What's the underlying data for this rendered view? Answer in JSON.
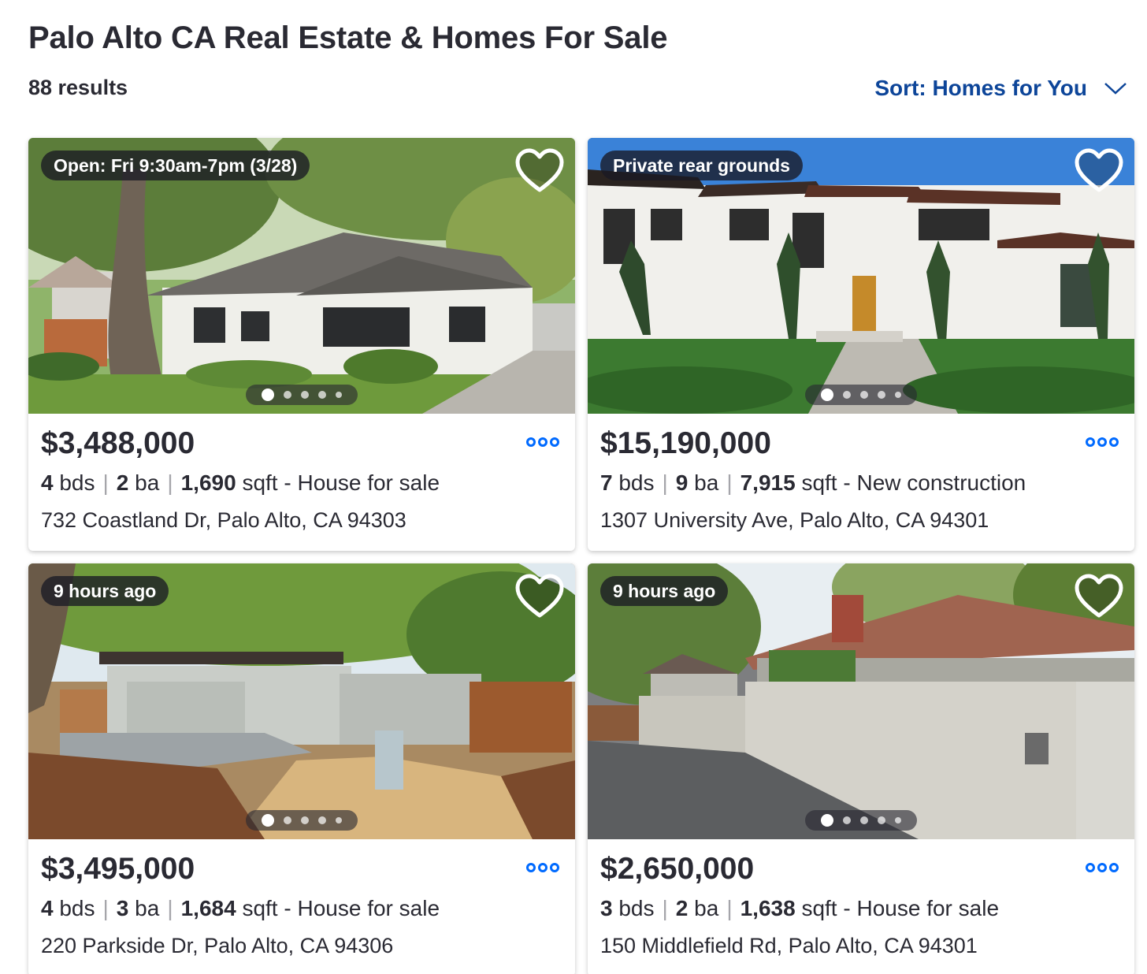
{
  "page": {
    "title": "Palo Alto CA Real Estate & Homes For Sale",
    "results": "88 results",
    "sort_label": "Sort: Homes for You"
  },
  "listings": [
    {
      "badge": "Open: Fri 9:30am-7pm (3/28)",
      "price": "$3,488,000",
      "beds": "4",
      "beds_unit": "bds",
      "baths": "2",
      "baths_unit": "ba",
      "sqft": "1,690",
      "sqft_unit": "sqft",
      "type": " - House for sale",
      "address": "732 Coastland Dr, Palo Alto, CA 94303",
      "saved": false,
      "photo_count_dots": 5,
      "active_photo": 1
    },
    {
      "badge": "Private rear grounds",
      "price": "$15,190,000",
      "beds": "7",
      "beds_unit": "bds",
      "baths": "9",
      "baths_unit": "ba",
      "sqft": "7,915",
      "sqft_unit": "sqft",
      "type": " - New construction",
      "address": "1307 University Ave, Palo Alto, CA 94301",
      "saved": false,
      "photo_count_dots": 5,
      "active_photo": 1
    },
    {
      "badge": "9 hours ago",
      "price": "$3,495,000",
      "beds": "4",
      "beds_unit": "bds",
      "baths": "3",
      "baths_unit": "ba",
      "sqft": "1,684",
      "sqft_unit": "sqft",
      "type": " - House for sale",
      "address": "220 Parkside Dr, Palo Alto, CA 94306",
      "saved": false,
      "photo_count_dots": 5,
      "active_photo": 1
    },
    {
      "badge": "9 hours ago",
      "price": "$2,650,000",
      "beds": "3",
      "beds_unit": "bds",
      "baths": "2",
      "baths_unit": "ba",
      "sqft": "1,638",
      "sqft_unit": "sqft",
      "type": " - House for sale",
      "address": "150 Middlefield Rd, Palo Alto, CA 94301",
      "saved": false,
      "photo_count_dots": 5,
      "active_photo": 1
    }
  ],
  "icons": {
    "heart": "heart-icon",
    "more": "more-options-icon",
    "sort_chevron": "chevron-down-icon"
  },
  "colors": {
    "accent_blue": "#006aff",
    "sort_blue": "#0d4599",
    "text": "#2a2a33"
  }
}
